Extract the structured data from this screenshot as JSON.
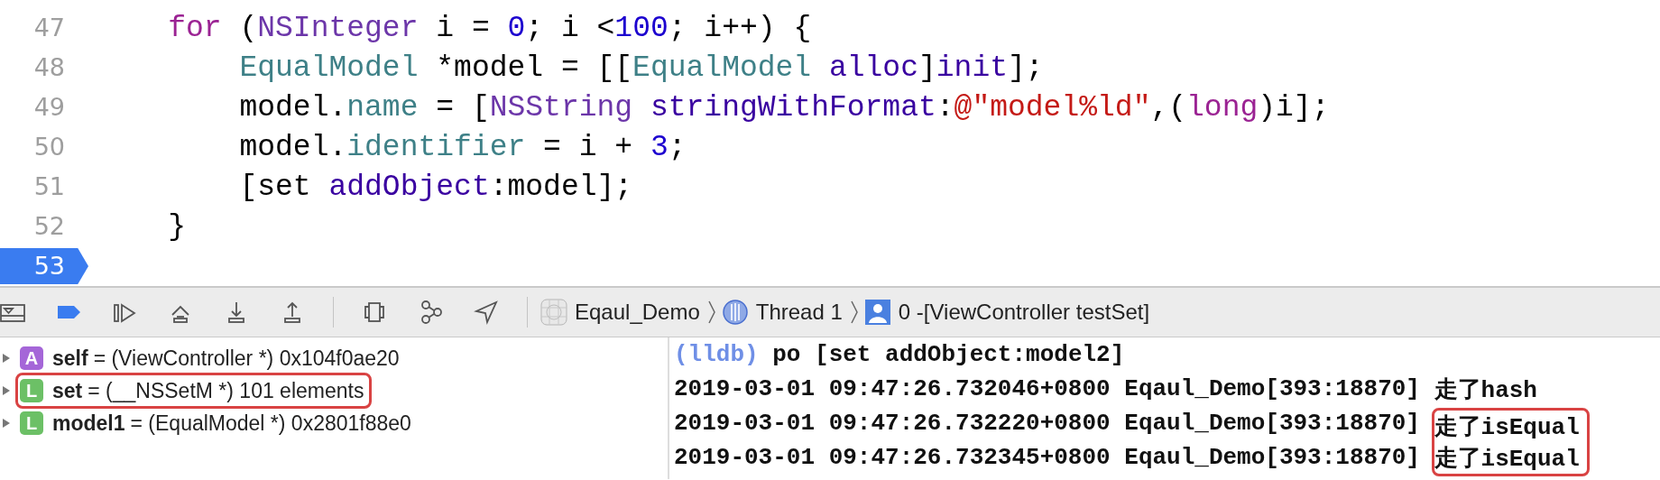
{
  "editor": {
    "lines": [
      {
        "number": "47",
        "breakpoint": false,
        "tokens": [
          {
            "text": "    for",
            "kind": "keyword"
          },
          {
            "text": " (",
            "kind": "plain"
          },
          {
            "text": "NSInteger",
            "kind": "type"
          },
          {
            "text": " i = ",
            "kind": "plain"
          },
          {
            "text": "0",
            "kind": "number"
          },
          {
            "text": "; i <",
            "kind": "plain"
          },
          {
            "text": "100",
            "kind": "number"
          },
          {
            "text": "; i++) {",
            "kind": "plain"
          }
        ]
      },
      {
        "number": "48",
        "breakpoint": false,
        "tokens": [
          {
            "text": "        EqualModel",
            "kind": "class"
          },
          {
            "text": " *model = [[",
            "kind": "plain"
          },
          {
            "text": "EqualModel",
            "kind": "class"
          },
          {
            "text": " alloc",
            "kind": "method"
          },
          {
            "text": "]",
            "kind": "plain"
          },
          {
            "text": "init",
            "kind": "method"
          },
          {
            "text": "];",
            "kind": "plain"
          }
        ]
      },
      {
        "number": "49",
        "breakpoint": false,
        "tokens": [
          {
            "text": "        model.",
            "kind": "plain"
          },
          {
            "text": "name",
            "kind": "class"
          },
          {
            "text": " = [",
            "kind": "plain"
          },
          {
            "text": "NSString",
            "kind": "type"
          },
          {
            "text": " stringWithFormat",
            "kind": "method"
          },
          {
            "text": ":",
            "kind": "plain"
          },
          {
            "text": "@\"model%ld\"",
            "kind": "string"
          },
          {
            "text": ",(",
            "kind": "plain"
          },
          {
            "text": "long",
            "kind": "keyword"
          },
          {
            "text": ")i];",
            "kind": "plain"
          }
        ]
      },
      {
        "number": "50",
        "breakpoint": false,
        "tokens": [
          {
            "text": "        model.",
            "kind": "plain"
          },
          {
            "text": "identifier",
            "kind": "class"
          },
          {
            "text": " = i + ",
            "kind": "plain"
          },
          {
            "text": "3",
            "kind": "number"
          },
          {
            "text": ";",
            "kind": "plain"
          }
        ]
      },
      {
        "number": "51",
        "breakpoint": false,
        "tokens": [
          {
            "text": "        [set ",
            "kind": "plain"
          },
          {
            "text": "addObject",
            "kind": "method"
          },
          {
            "text": ":model];",
            "kind": "plain"
          }
        ]
      },
      {
        "number": "52",
        "breakpoint": false,
        "tokens": [
          {
            "text": "    }",
            "kind": "plain"
          }
        ]
      },
      {
        "number": "53",
        "breakpoint": true
      }
    ]
  },
  "debug_bar": {
    "breakpoints_active": true,
    "breadcrumbs": [
      {
        "kind": "app",
        "label": "Eqaul_Demo"
      },
      {
        "kind": "thread",
        "label": "Thread 1"
      },
      {
        "kind": "frame",
        "label": "0 -[ViewController testSet]"
      }
    ]
  },
  "variables": [
    {
      "kind": "argument",
      "badge": "A",
      "name": "self",
      "detail": "= (ViewController *) 0x104f0ae20",
      "expanded": false,
      "marked": false
    },
    {
      "kind": "local",
      "badge": "L",
      "name": "set",
      "detail": "= (__NSSetM *) 101 elements",
      "expanded": false,
      "marked": true
    },
    {
      "kind": "local",
      "badge": "L",
      "name": "model1",
      "detail": "= (EqualModel *) 0x2801f88e0",
      "expanded": false,
      "marked": false
    }
  ],
  "console": [
    {
      "kind": "prompt",
      "prompt": "(lldb)",
      "command": "po [set addObject:model2]"
    },
    {
      "kind": "log",
      "header": "2019-03-01 09:47:26.732046+0800 Eqaul_Demo[393:18870]",
      "message": "走了hash",
      "marked": false
    },
    {
      "kind": "log",
      "header": "2019-03-01 09:47:26.732220+0800 Eqaul_Demo[393:18870]",
      "message": "走了isEqual",
      "marked": true
    },
    {
      "kind": "log",
      "header": "2019-03-01 09:47:26.732345+0800 Eqaul_Demo[393:18870]",
      "message": "走了isEqual",
      "marked": true
    }
  ]
}
